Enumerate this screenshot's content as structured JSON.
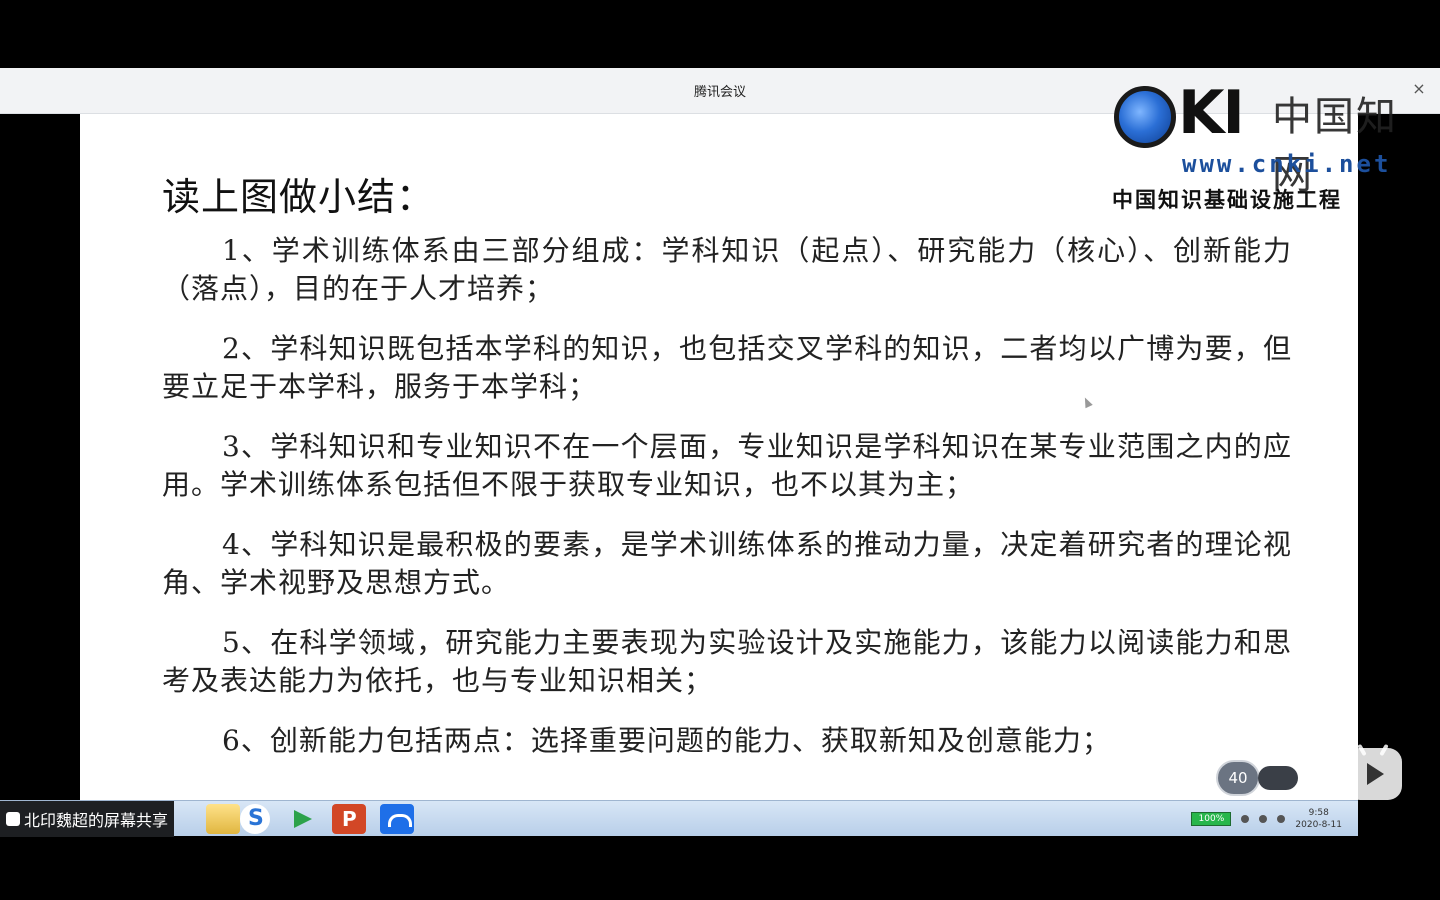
{
  "window": {
    "title": "腾讯会议",
    "close_label": "×"
  },
  "slide": {
    "title": "读上图做小结：",
    "points": [
      "1、学术训练体系由三部分组成：学科知识（起点）、研究能力（核心）、创新能力（落点），目的在于人才培养；",
      "2、学科知识既包括本学科的知识，也包括交叉学科的知识，二者均以广博为要，但要立足于本学科，服务于本学科；",
      "3、学科知识和专业知识不在一个层面，专业知识是学科知识在某专业范围之内的应用。学术训练体系包括但不限于获取专业知识，也不以其为主；",
      "4、学科知识是最积极的要素，是学术训练体系的推动力量，决定着研究者的理论视角、学术视野及思想方式。",
      "5、在科学领域，研究能力主要表现为实验设计及实施能力，该能力以阅读能力和思考及表达能力为依托，也与专业知识相关；",
      "6、创新能力包括两点：选择重要问题的能力、获取新知及创意能力；"
    ]
  },
  "watermark": {
    "logo_text": "KI",
    "chinese_name": "中国知网",
    "url": "www.cnki.net",
    "org": "中国知识基础设施工程"
  },
  "taskbar": {
    "share_label": "北印魏超的屏幕共享",
    "battery": "100%",
    "time": "9:58",
    "date": "2020-8-11"
  },
  "overlay": {
    "zoom_level": "40"
  }
}
